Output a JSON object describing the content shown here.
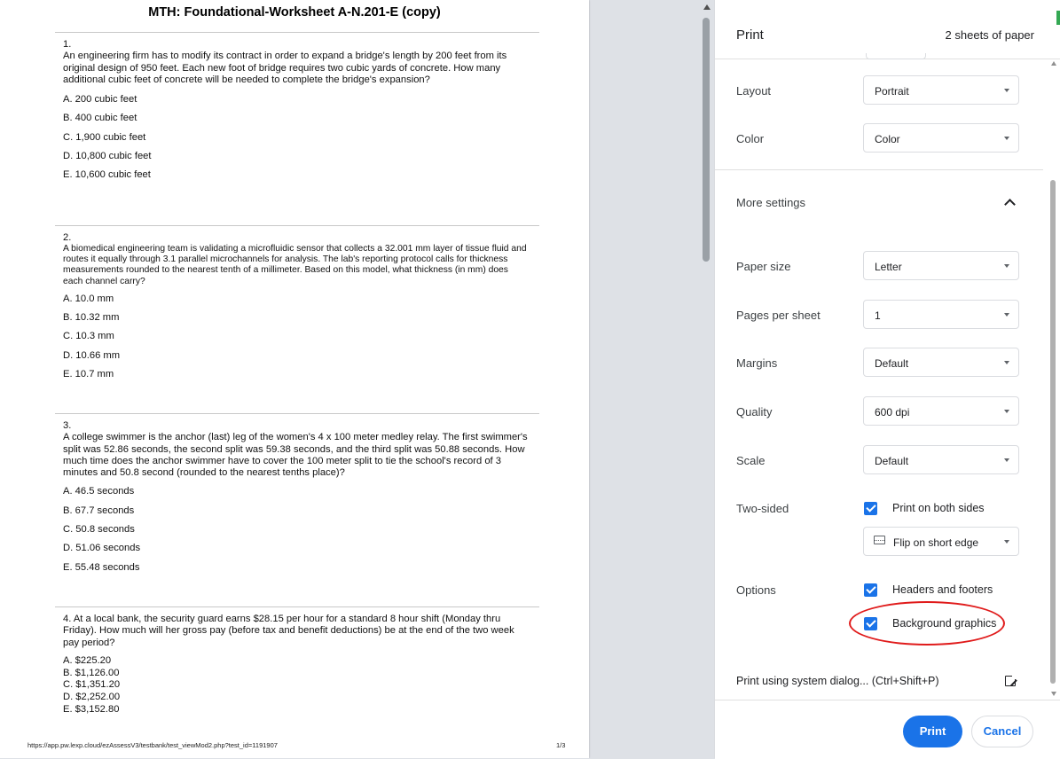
{
  "preview": {
    "doc_title": "MTH: Foundational-Worksheet A-N.201-E (copy)",
    "questions": [
      {
        "number": "1.",
        "text": "An engineering firm has to modify its contract in order to expand a bridge's length by 200 feet from its original design of 950 feet.  Each new foot of bridge requires two cubic yards of concrete.  How many additional cubic feet of concrete will be needed to complete the bridge's expansion?",
        "choices": [
          "A. 200 cubic feet",
          "B. 400 cubic feet",
          "C. 1,900 cubic feet",
          "D. 10,800 cubic feet",
          "E. 10,600 cubic feet"
        ]
      },
      {
        "number": "2.",
        "text": "A biomedical engineering team is validating a microfluidic sensor that collects a 32.001 mm layer of tissue fluid and routes it equally through 3.1 parallel microchannels for analysis. The lab's reporting protocol calls for thickness measurements rounded to the nearest tenth of a millimeter. Based on this model, what thickness (in mm) does each channel carry?",
        "choices": [
          "A. 10.0 mm",
          "B. 10.32 mm",
          "C. 10.3 mm",
          "D. 10.66 mm",
          "E. 10.7 mm"
        ]
      },
      {
        "number": "3.",
        "text": "A college swimmer is the anchor (last) leg of the women's 4 x 100 meter medley relay.  The first swimmer's split was 52.86 seconds, the second split was 59.38 seconds, and the third split was 50.88 seconds.  How much time does the anchor swimmer have to cover the 100 meter split to tie the school's record of 3 minutes and 50.8 second (rounded to the nearest tenths place)?",
        "choices": [
          "A. 46.5 seconds",
          "B. 67.7 seconds",
          "C. 50.8 seconds",
          "D. 51.06 seconds",
          "E. 55.48 seconds"
        ]
      },
      {
        "number": "4.",
        "text": "At a local bank, the security guard earns $28.15 per hour for a standard 8 hour shift (Monday thru Friday). How much will her gross pay (before tax and benefit deductions) be at the end of the two week pay period?",
        "choices": [
          "A. $225.20",
          "B. $1,126.00",
          "C. $1,351.20",
          "D. $2,252.00",
          "E. $3,152.80"
        ]
      }
    ],
    "footer_url": "https://app.pw.lexp.cloud/ezAssessV3/testbank/test_viewMod2.php?test_id=1191907",
    "footer_page": "1/3"
  },
  "panel": {
    "title": "Print",
    "sheets": "2 sheets of paper",
    "layout": {
      "label": "Layout",
      "value": "Portrait"
    },
    "color": {
      "label": "Color",
      "value": "Color"
    },
    "more_settings": "More settings",
    "paper_size": {
      "label": "Paper size",
      "value": "Letter"
    },
    "pages_per_sheet": {
      "label": "Pages per sheet",
      "value": "1"
    },
    "margins": {
      "label": "Margins",
      "value": "Default"
    },
    "quality": {
      "label": "Quality",
      "value": "600 dpi"
    },
    "scale": {
      "label": "Scale",
      "value": "Default"
    },
    "two_sided": {
      "label": "Two-sided",
      "checkbox": "Print on both sides",
      "flip": "Flip on short edge"
    },
    "options": {
      "label": "Options",
      "headers_footers": "Headers and footers",
      "background_graphics": "Background graphics"
    },
    "system_dialog": "Print using system dialog... (Ctrl+Shift+P)",
    "print_button": "Print",
    "cancel_button": "Cancel"
  },
  "colors": {
    "accent": "#1a73e8",
    "highlight": "#e01b1b"
  }
}
